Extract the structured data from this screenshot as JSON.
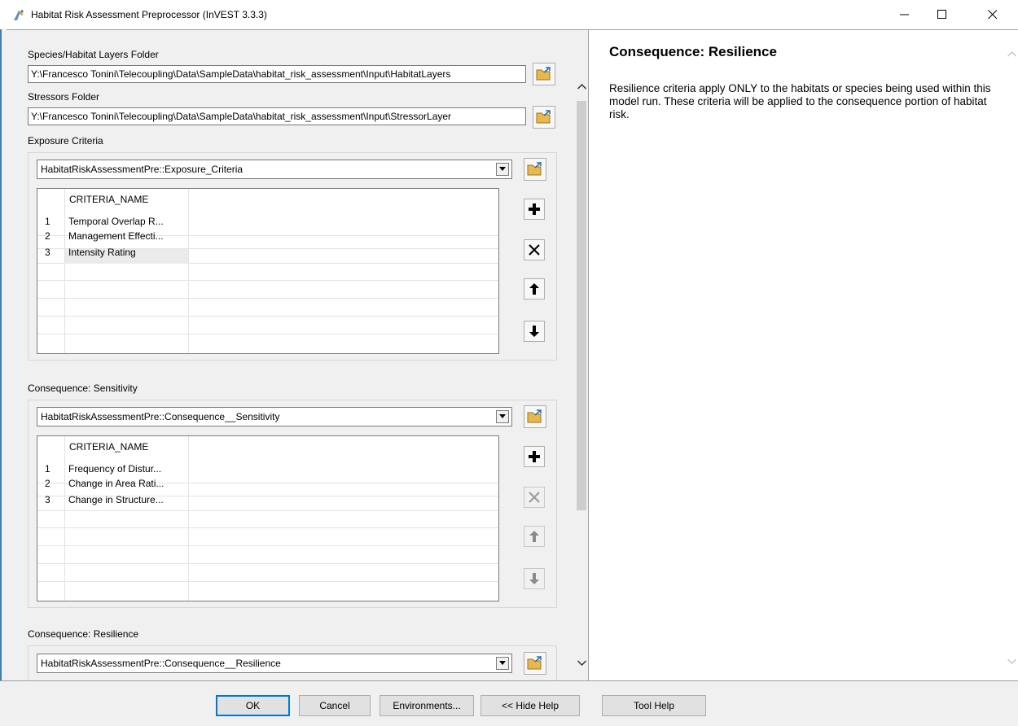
{
  "window": {
    "title": "Habitat Risk Assessment Preprocessor (InVEST 3.3.3)",
    "icon": "python-tool-icon",
    "controls": [
      "minimize-icon",
      "maximize-icon",
      "close-icon"
    ]
  },
  "form": {
    "species_label": "Species/Habitat Layers Folder",
    "species_value": "Y:\\Francesco Tonini\\Telecoupling\\Data\\SampleData\\habitat_risk_assessment\\Input\\HabitatLayers",
    "stressors_label": "Stressors Folder",
    "stressors_value": "Y:\\Francesco Tonini\\Telecoupling\\Data\\SampleData\\habitat_risk_assessment\\Input\\StressorLayer",
    "exposure": {
      "label": "Exposure Criteria",
      "combo": "HabitatRiskAssessmentPre::Exposure_Criteria",
      "header": "CRITERIA_NAME",
      "rows": [
        {
          "num": "1",
          "name": "Temporal Overlap R..."
        },
        {
          "num": "2",
          "name": "Management Effecti..."
        },
        {
          "num": "3",
          "name": "Intensity Rating"
        }
      ]
    },
    "sensitivity": {
      "label": "Consequence: Sensitivity",
      "combo": "HabitatRiskAssessmentPre::Consequence__Sensitivity",
      "header": "CRITERIA_NAME",
      "rows": [
        {
          "num": "1",
          "name": "Frequency of Distur..."
        },
        {
          "num": "2",
          "name": "Change in Area Rati..."
        },
        {
          "num": "3",
          "name": "Change in Structure..."
        }
      ]
    },
    "resilience": {
      "label": "Consequence: Resilience",
      "combo": "HabitatRiskAssessmentPre::Consequence__Resilience"
    }
  },
  "help": {
    "title": "Consequence: Resilience",
    "body": "Resilience criteria apply ONLY to the habitats or species being used within this model run. These criteria will be applied to the consequence portion of habitat risk."
  },
  "buttons": {
    "ok": "OK",
    "cancel": "Cancel",
    "environments": "Environments...",
    "hide_help": "<< Hide Help",
    "tool_help": "Tool Help"
  },
  "colors": {
    "panel_bg": "#f0f0f0",
    "accent": "#0078d7",
    "folder_yellow": "#e8b84a"
  }
}
